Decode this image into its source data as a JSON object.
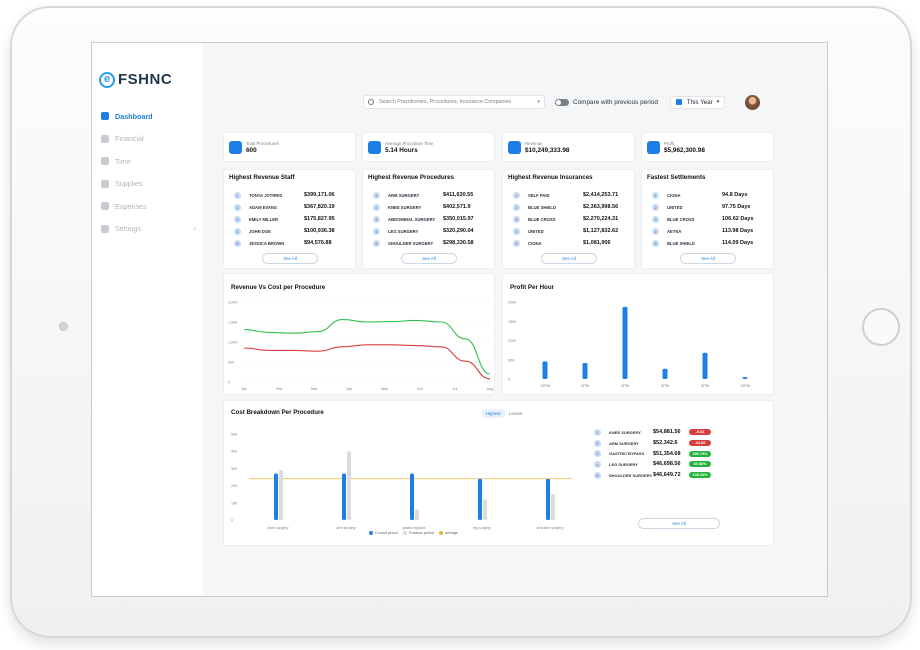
{
  "app": {
    "logo_letter": "e",
    "logo_text": "FSHNC"
  },
  "sidebar": {
    "items": [
      {
        "label": "Dashboard",
        "icon": "grid-icon",
        "active": true
      },
      {
        "label": "Financial",
        "icon": "bar-chart-icon"
      },
      {
        "label": "Time",
        "icon": "clock-icon"
      },
      {
        "label": "Supplies",
        "icon": "list-icon"
      },
      {
        "label": "Expenses",
        "icon": "dollar-icon"
      },
      {
        "label": "Settings",
        "icon": "gear-icon",
        "chevron": "›"
      }
    ]
  },
  "topbar": {
    "search_placeholder": "Search Practitioners, Procedures, Insurance Companies",
    "dropdown_arrow": "▾",
    "compare_label": "Compare with previous period",
    "period_label": "This Year",
    "period_arrow": "▾"
  },
  "kpis": [
    {
      "label": "Total Procedures",
      "value": "600"
    },
    {
      "label": "Average Procedure Time",
      "value": "5.14 Hours"
    },
    {
      "label": "Revenue",
      "value": "$10,249,333.98"
    },
    {
      "label": "Profit",
      "value": "$5,962,300.98"
    }
  ],
  "tables": [
    {
      "title": "Highest Revenue Staff",
      "rows": [
        [
          "TONYA JOTRRIS",
          "$399,171.06"
        ],
        [
          "ADAM EVANS",
          "$367,820.19"
        ],
        [
          "EMILY MILLER",
          "$175,827.95"
        ],
        [
          "JOHN DOE",
          "$100,936.38"
        ],
        [
          "JESSICA BROWN",
          "$94,576.88"
        ]
      ],
      "see_all": "See All"
    },
    {
      "title": "Highest Revenue Procedures",
      "rows": [
        [
          "ARM SURGERY",
          "$411,630.55"
        ],
        [
          "KNEE SURGERY",
          "$402,571.9"
        ],
        [
          "ABDOMINAL SURGERY",
          "$350,015.97"
        ],
        [
          "LEG SURGERY",
          "$320,290.04"
        ],
        [
          "SHOULDER SURGERY",
          "$298,330.58"
        ]
      ],
      "see_all": "See All"
    },
    {
      "title": "Highest Revenue Insurances",
      "rows": [
        [
          "SELF PAID",
          "$2,414,253.71"
        ],
        [
          "BLUE SHIELD",
          "$2,363,998.56"
        ],
        [
          "BLUE CROSS",
          "$2,270,224.31"
        ],
        [
          "UNITED",
          "$1,127,832.62"
        ],
        [
          "CIGNA",
          "$1,081,906"
        ]
      ],
      "see_all": "See All"
    },
    {
      "title": "Fastest Settlements",
      "rows": [
        [
          "CIGNA",
          "94.8 Days"
        ],
        [
          "UNITED",
          "97.75 Days"
        ],
        [
          "BLUE CROSS",
          "106.62 Days"
        ],
        [
          "AETNA",
          "113.98 Days"
        ],
        [
          "BLUE SHIELD",
          "114.09 Days"
        ]
      ],
      "see_all": "See All"
    }
  ],
  "chart_data": [
    {
      "type": "line",
      "title": "Revenue Vs Cost per Procedure",
      "categories": [
        "Jan",
        "Feb",
        "Mar",
        "Apr",
        "May",
        "Jun",
        "Jul",
        "Aug"
      ],
      "yticks": [
        "2,00K",
        "1,50K",
        "1,00K",
        "500",
        "0"
      ],
      "ylim": [
        0,
        2000
      ],
      "series": [
        {
          "color": "#2ec14a",
          "values": [
            1310,
            1240,
            1220,
            1260,
            1560,
            1500,
            1510,
            1540,
            1500,
            1080,
            200
          ]
        },
        {
          "color": "#d83d3d",
          "values": [
            850,
            790,
            790,
            770,
            880,
            930,
            930,
            910,
            880,
            520,
            80
          ]
        }
      ]
    },
    {
      "type": "bar",
      "title": "Profit Per Hour",
      "categories": [
        "12PM",
        "2PM",
        "4PM",
        "6PM",
        "8PM",
        "10PM"
      ],
      "yticks": [
        "240K",
        "180K",
        "120K",
        "60K",
        "0"
      ],
      "ylim": [
        0,
        240000
      ],
      "values": [
        55000,
        50000,
        225000,
        32000,
        82000,
        6000
      ],
      "color": "#1d7fe6"
    },
    {
      "type": "bar",
      "title": "Cost Breakdown Per Procedure",
      "categories": [
        "knee surgery",
        "arm surgery",
        "gastric bypass",
        "leg surgery",
        "shoulder surgery"
      ],
      "yticks": [
        "50K",
        "40K",
        "30K",
        "20K",
        "10K",
        "0"
      ],
      "ylim": [
        0,
        50000
      ],
      "series": [
        {
          "name": "Current period",
          "color": "#1d7fe6",
          "values": [
            27000,
            27000,
            27000,
            24000,
            24000
          ]
        },
        {
          "name": "Previous period",
          "color": "#dcdcdc",
          "values": [
            29000,
            40000,
            6000,
            12000,
            15000
          ]
        },
        {
          "name": "average",
          "color": "#f0b33a",
          "values": [
            24000,
            24000,
            24000,
            24000,
            24000
          ]
        }
      ]
    }
  ],
  "breakdown": {
    "seg_highest": "Highest",
    "seg_lowest": "Lowest",
    "see_all": "See All",
    "rows": [
      [
        "KNEE SURGERY",
        "$54,881.56",
        "-5.81",
        "#d83d3d"
      ],
      [
        "ARM SURGERY",
        "$52,342.6",
        "-34.89",
        "#d83d3d"
      ],
      [
        "GASTRIC BYPASS",
        "$51,354.68",
        "286.79%",
        "#22b33a"
      ],
      [
        "LEG SURGERY",
        "$46,698.56",
        "83.86%",
        "#22b33a"
      ],
      [
        "SHOULDER SURGERY",
        "$46,649.72",
        "108.10%",
        "#22b33a"
      ]
    ]
  }
}
